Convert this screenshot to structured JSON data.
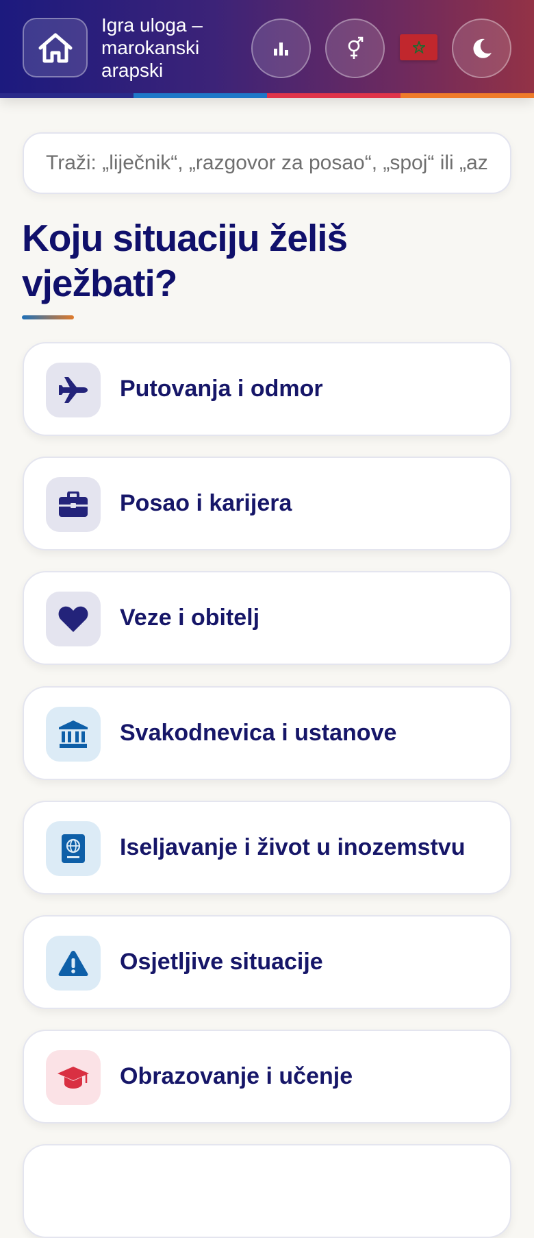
{
  "header": {
    "title": "Igra uloga – marokanski arapski",
    "title_lines": [
      "Igra uloga –",
      "marokanski",
      "arapski"
    ],
    "home_icon": "home-icon",
    "stats_icon": "bar-chart-icon",
    "gender_icon": "gender-icon",
    "flag": "morocco-flag",
    "theme_icon": "moon-icon",
    "stripe_colors": [
      "#2a2a8a",
      "#1e78c8",
      "#e0344a",
      "#ef7b2a"
    ]
  },
  "search": {
    "placeholder": "Traži: „liječnik“, „razgovor za posao“, „spoj“ ili „azil“"
  },
  "main": {
    "heading": "Koju situaciju želiš vježbati?",
    "categories": [
      {
        "label": "Putovanja i odmor",
        "icon": "airplane-icon",
        "tint": "#e4e4ef",
        "color": "#23237a"
      },
      {
        "label": "Posao i karijera",
        "icon": "briefcase-icon",
        "tint": "#e4e4ef",
        "color": "#23237a"
      },
      {
        "label": "Veze i obitelj",
        "icon": "heart-icon",
        "tint": "#e4e4ef",
        "color": "#23237a"
      },
      {
        "label": "Svakodnevica i ustanove",
        "icon": "institution-icon",
        "tint": "#dcebf6",
        "color": "#0e5fa8"
      },
      {
        "label": "Iseljavanje i život u inozemstvu",
        "icon": "passport-icon",
        "tint": "#dcebf6",
        "color": "#0e5fa8"
      },
      {
        "label": "Osjetljive situacije",
        "icon": "warning-icon",
        "tint": "#dcebf6",
        "color": "#0e5fa8"
      },
      {
        "label": "Obrazovanje i učenje",
        "icon": "graduation-cap-icon",
        "tint": "#fbe2e6",
        "color": "#d93042"
      }
    ]
  }
}
